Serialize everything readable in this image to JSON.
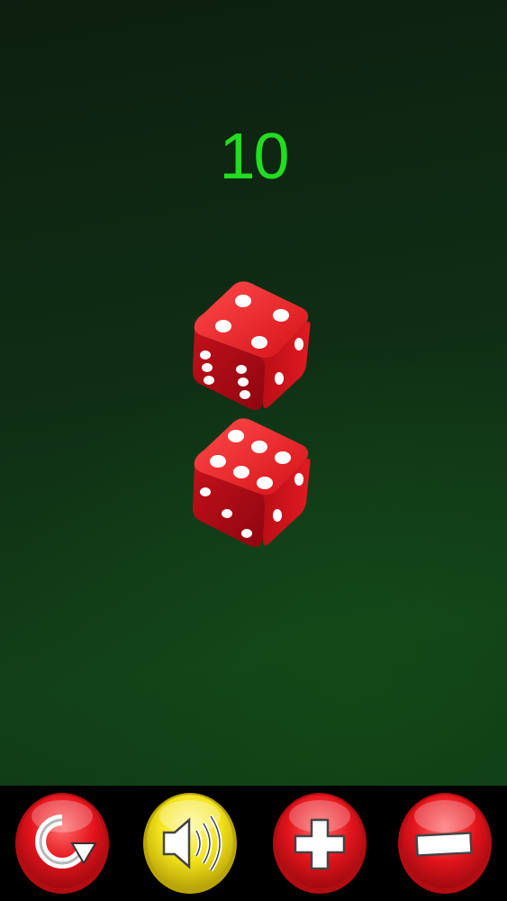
{
  "game": {
    "total": "10",
    "dice": [
      {
        "top_face": 4,
        "left_face": 6,
        "right_face": 2
      },
      {
        "top_face": 6,
        "left_face": 3,
        "right_face": 2
      }
    ]
  },
  "toolbar": {
    "buttons": [
      {
        "name": "roll-button",
        "icon": "refresh-icon",
        "color": "#e4141c"
      },
      {
        "name": "sound-button",
        "icon": "speaker-icon",
        "color": "#f2e21a"
      },
      {
        "name": "add-die-button",
        "icon": "plus-icon",
        "color": "#e4141c"
      },
      {
        "name": "remove-die-button",
        "icon": "minus-icon",
        "color": "#e4141c"
      }
    ]
  },
  "colors": {
    "score": "#22dd22",
    "die": "#d4141c",
    "felt": "#0f3a14"
  }
}
